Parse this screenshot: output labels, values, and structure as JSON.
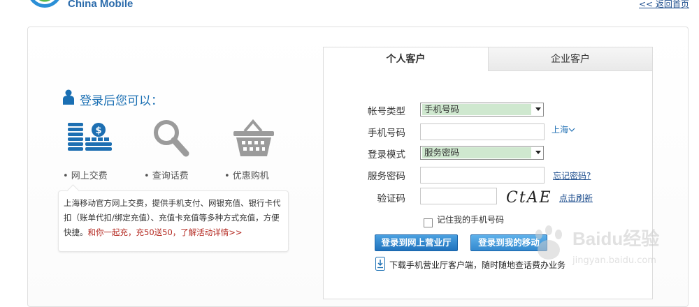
{
  "header": {
    "logo_text": "China Mobile",
    "back_link": "<< 返回首页"
  },
  "promo": {
    "title": "登录后您可以：",
    "features": [
      {
        "icon": "coins-dollar-icon",
        "label": "• 网上交费"
      },
      {
        "icon": "magnifier-icon",
        "label": "• 查询话费"
      },
      {
        "icon": "shopping-basket-icon",
        "label": "• 优惠购机"
      }
    ],
    "info_text": "上海移动官方网上交费，提供手机支付、网银充值、银行卡代扣（账单代扣/绑定充值）、充值卡充值等多种方式充值，方便快捷。",
    "info_highlight": "和你一起充，充50送50，了解活动详情>>"
  },
  "tabs": [
    {
      "label": "个人客户",
      "active": true
    },
    {
      "label": "企业客户",
      "active": false
    }
  ],
  "form": {
    "account_type_label": "帐号类型",
    "account_type_value": "手机号码",
    "phone_label": "手机号码",
    "phone_value": "",
    "region": "上海",
    "login_mode_label": "登录模式",
    "login_mode_value": "服务密码",
    "password_label": "服务密码",
    "password_value": "",
    "forgot_link": "忘记密码?",
    "captcha_label": "验证码",
    "captcha_value": "",
    "captcha_text": "CtAE",
    "refresh_link": "点击刷新",
    "remember_label": "记住我的手机号码",
    "remember_checked": false,
    "login_button": "登录到网上营业厅",
    "login_mobile_button": "登录到我的移动",
    "download_text": "下载手机营业厅客户端，随时随地查话费办业务"
  },
  "watermark": {
    "text": "Baidu经验",
    "url": "jingyan.baidu.com"
  },
  "colors": {
    "brand_blue": "#1a6fb3",
    "select_highlight": "#cfe8cf",
    "promo_red": "#b3261e"
  }
}
